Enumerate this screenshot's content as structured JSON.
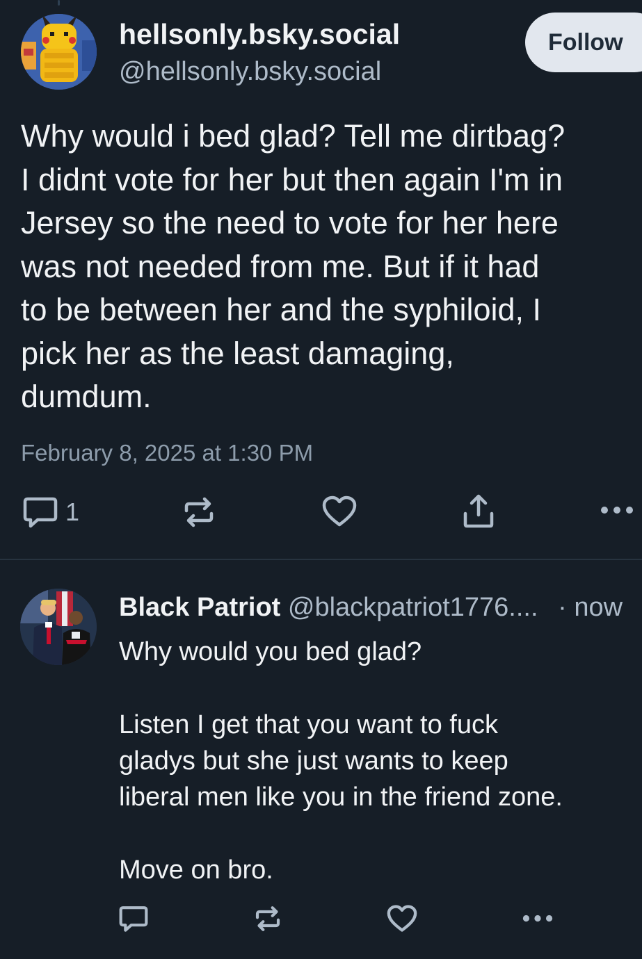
{
  "main_post": {
    "author_name": "hellsonly.bsky.social",
    "author_handle": "@hellsonly.bsky.social",
    "follow_label": "Follow",
    "text": "Why would i bed glad? Tell me dirtbag?\nI didnt vote for her but then again I'm in\nJersey so the need to vote for her here\nwas not needed from me. But if it had\nto be between her and the syphiloid, I\npick her as the least damaging,\ndumdum.",
    "timestamp": "February 8, 2025 at 1:30 PM",
    "reply_count": "1",
    "icons": [
      "reply-icon",
      "repost-icon",
      "like-icon",
      "share-icon",
      "more-icon"
    ]
  },
  "reply_post": {
    "author_name": "Black Patriot",
    "author_handle": "@blackpatriot1776....",
    "time": "· now",
    "text": "Why would you bed glad?\n\nListen I get that you want to fuck\ngladys but she just wants to keep\nliberal men like you in the friend zone.\n\nMove on bro.",
    "icons": [
      "reply-icon",
      "repost-icon",
      "like-icon",
      "more-icon"
    ]
  },
  "colors": {
    "background": "#161e27",
    "text": "#f1f3f5",
    "secondary_text": "#aebbc9",
    "follow_button_bg": "#e2e7ee",
    "icon": "#aebbc9"
  }
}
